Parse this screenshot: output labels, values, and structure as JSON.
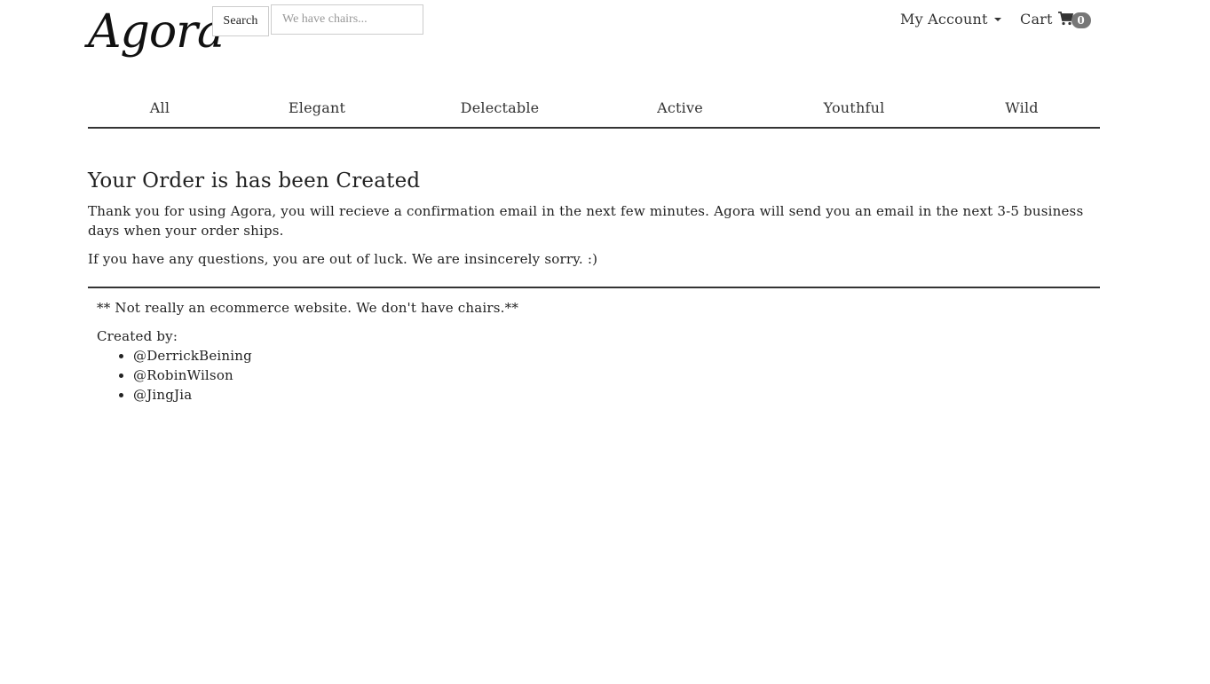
{
  "header": {
    "logo": "Agora",
    "search_button": "Search",
    "search_placeholder": "We have chairs...",
    "account_label": "My Account",
    "cart_label": "Cart",
    "cart_count": "0"
  },
  "nav": {
    "items": [
      {
        "label": "All"
      },
      {
        "label": "Elegant"
      },
      {
        "label": "Delectable"
      },
      {
        "label": "Active"
      },
      {
        "label": "Youthful"
      },
      {
        "label": "Wild"
      }
    ]
  },
  "main": {
    "title": "Your Order is has been Created",
    "confirmation": "Thank you for using Agora, you will recieve a confirmation email in the next few minutes. Agora will send you an email in the next 3-5 business days when your order ships.",
    "questions": "If you have any questions, you are out of luck. We are insincerely sorry. :)"
  },
  "footer": {
    "disclaimer": "** Not really an ecommerce website. We don't have chairs.**",
    "created_by": "Created by:",
    "authors": [
      "@DerrickBeining",
      "@RobinWilson",
      "@JingJia"
    ]
  },
  "colors": {
    "text": "#222222",
    "rule": "#333333",
    "badge": "#777777",
    "input_border": "#cccccc"
  }
}
